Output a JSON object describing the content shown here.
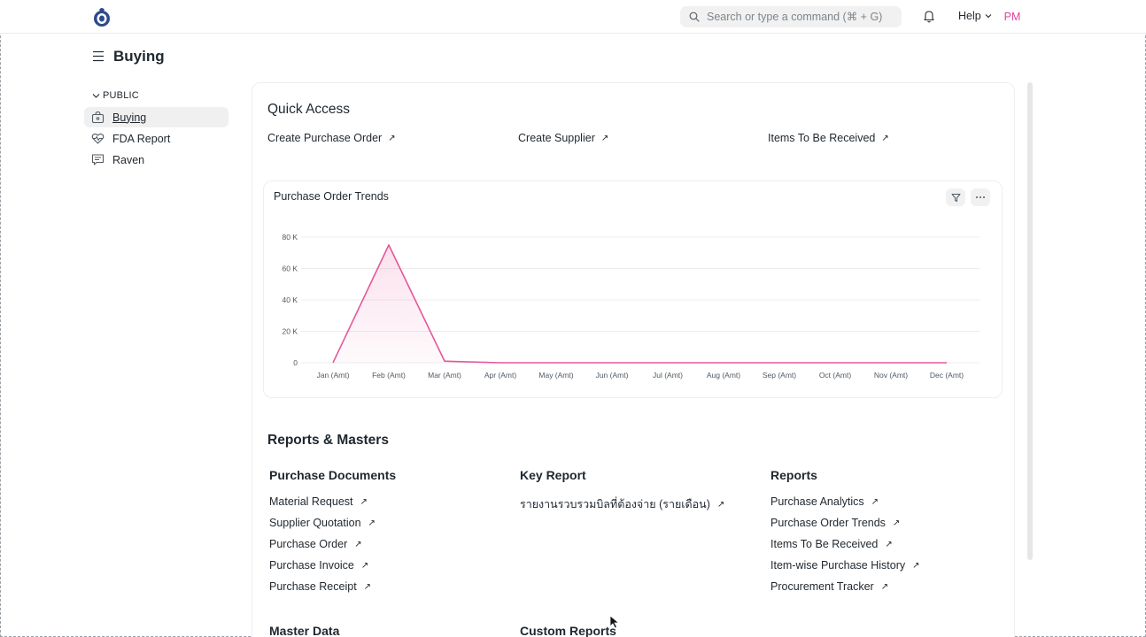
{
  "navbar": {
    "search_placeholder": "Search or type a command (⌘ + G)",
    "help_label": "Help",
    "avatar_initials": "PM"
  },
  "page": {
    "title": "Buying"
  },
  "sidebar": {
    "section_label": "PUBLIC",
    "items": [
      {
        "label": "Buying",
        "icon": "shopping-bag-icon",
        "active": true
      },
      {
        "label": "FDA Report",
        "icon": "heart-pulse-icon",
        "active": false
      },
      {
        "label": "Raven",
        "icon": "chat-icon",
        "active": false
      }
    ]
  },
  "quick_access": {
    "title": "Quick Access",
    "links": [
      "Create Purchase Order",
      "Create Supplier",
      "Items To Be Received"
    ]
  },
  "chart_data": {
    "type": "area",
    "title": "Purchase Order Trends",
    "categories": [
      "Jan (Amt)",
      "Feb (Amt)",
      "Mar (Amt)",
      "Apr (Amt)",
      "May (Amt)",
      "Jun (Amt)",
      "Jul (Amt)",
      "Aug (Amt)",
      "Sep (Amt)",
      "Oct (Amt)",
      "Nov (Amt)",
      "Dec (Amt)"
    ],
    "values": [
      0,
      75000,
      1000,
      0,
      0,
      0,
      0,
      0,
      0,
      0,
      0,
      0
    ],
    "y_ticks": [
      "0",
      "20 K",
      "40 K",
      "60 K",
      "80 K"
    ],
    "ylim": [
      0,
      80000
    ],
    "grid": true,
    "color": "#e4589a"
  },
  "reports_masters": {
    "title": "Reports & Masters",
    "groups": [
      {
        "title": "Purchase Documents",
        "links": [
          "Material Request",
          "Supplier Quotation",
          "Purchase Order",
          "Purchase Invoice",
          "Purchase Receipt"
        ]
      },
      {
        "title": "Key Report",
        "links": [
          "รายงานรวบรวมบิลที่ต้องจ่าย (รายเดือน)"
        ]
      },
      {
        "title": "Reports",
        "links": [
          "Purchase Analytics",
          "Purchase Order Trends",
          "Items To Be Received",
          "Item-wise Purchase History",
          "Procurement Tracker"
        ]
      }
    ],
    "bottom_groups": [
      "Master Data",
      "Custom Reports"
    ]
  }
}
